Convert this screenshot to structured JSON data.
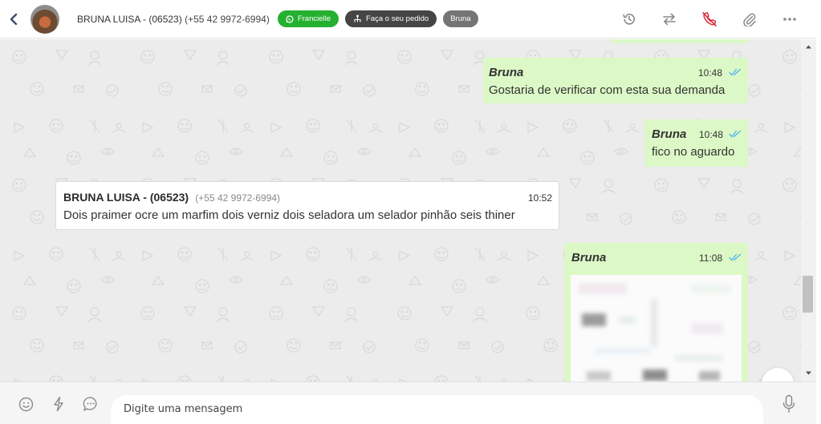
{
  "header": {
    "back_icon": "chevron-left-icon",
    "contact_name": "BRUNA LUISA - (06523)",
    "contact_phone": "(+55 42 9972-6994)",
    "tags": {
      "agent": "Francielle",
      "order": "Faça o seu pedido",
      "user": "Bruna"
    },
    "actions": [
      "history-icon",
      "transfer-icon",
      "end-call-icon",
      "attachment-icon",
      "more-icon"
    ]
  },
  "messages": [
    {
      "direction": "out",
      "sender": "Bruna",
      "time": "10:48",
      "text": "Gostaria de verificar com esta sua demanda",
      "status": "read"
    },
    {
      "direction": "out",
      "sender": "Bruna",
      "time": "10:48",
      "text": "fico no aguardo",
      "status": "read"
    },
    {
      "direction": "in",
      "sender": "BRUNA LUISA - (06523)",
      "sender_phone": "(+55 42 9972-6994)",
      "time": "10:52",
      "text": "Dois praimer ocre um marfim dois verniz dois seladora um selador pinhão seis thiner"
    },
    {
      "direction": "out",
      "sender": "Bruna",
      "time": "11:08",
      "type": "image",
      "status": "read"
    }
  ],
  "composer": {
    "placeholder": "Digite uma mensagem",
    "icons": [
      "emoji-icon",
      "quick-reply-icon",
      "chat-icon",
      "microphone-icon"
    ]
  },
  "colors": {
    "outgoing_bubble": "#dcf8c6",
    "incoming_bubble": "#ffffff",
    "chat_background": "#ececec",
    "read_ticks": "#4fb6ec",
    "tag_green": "#25b030",
    "end_call_red": "#d9303e"
  }
}
